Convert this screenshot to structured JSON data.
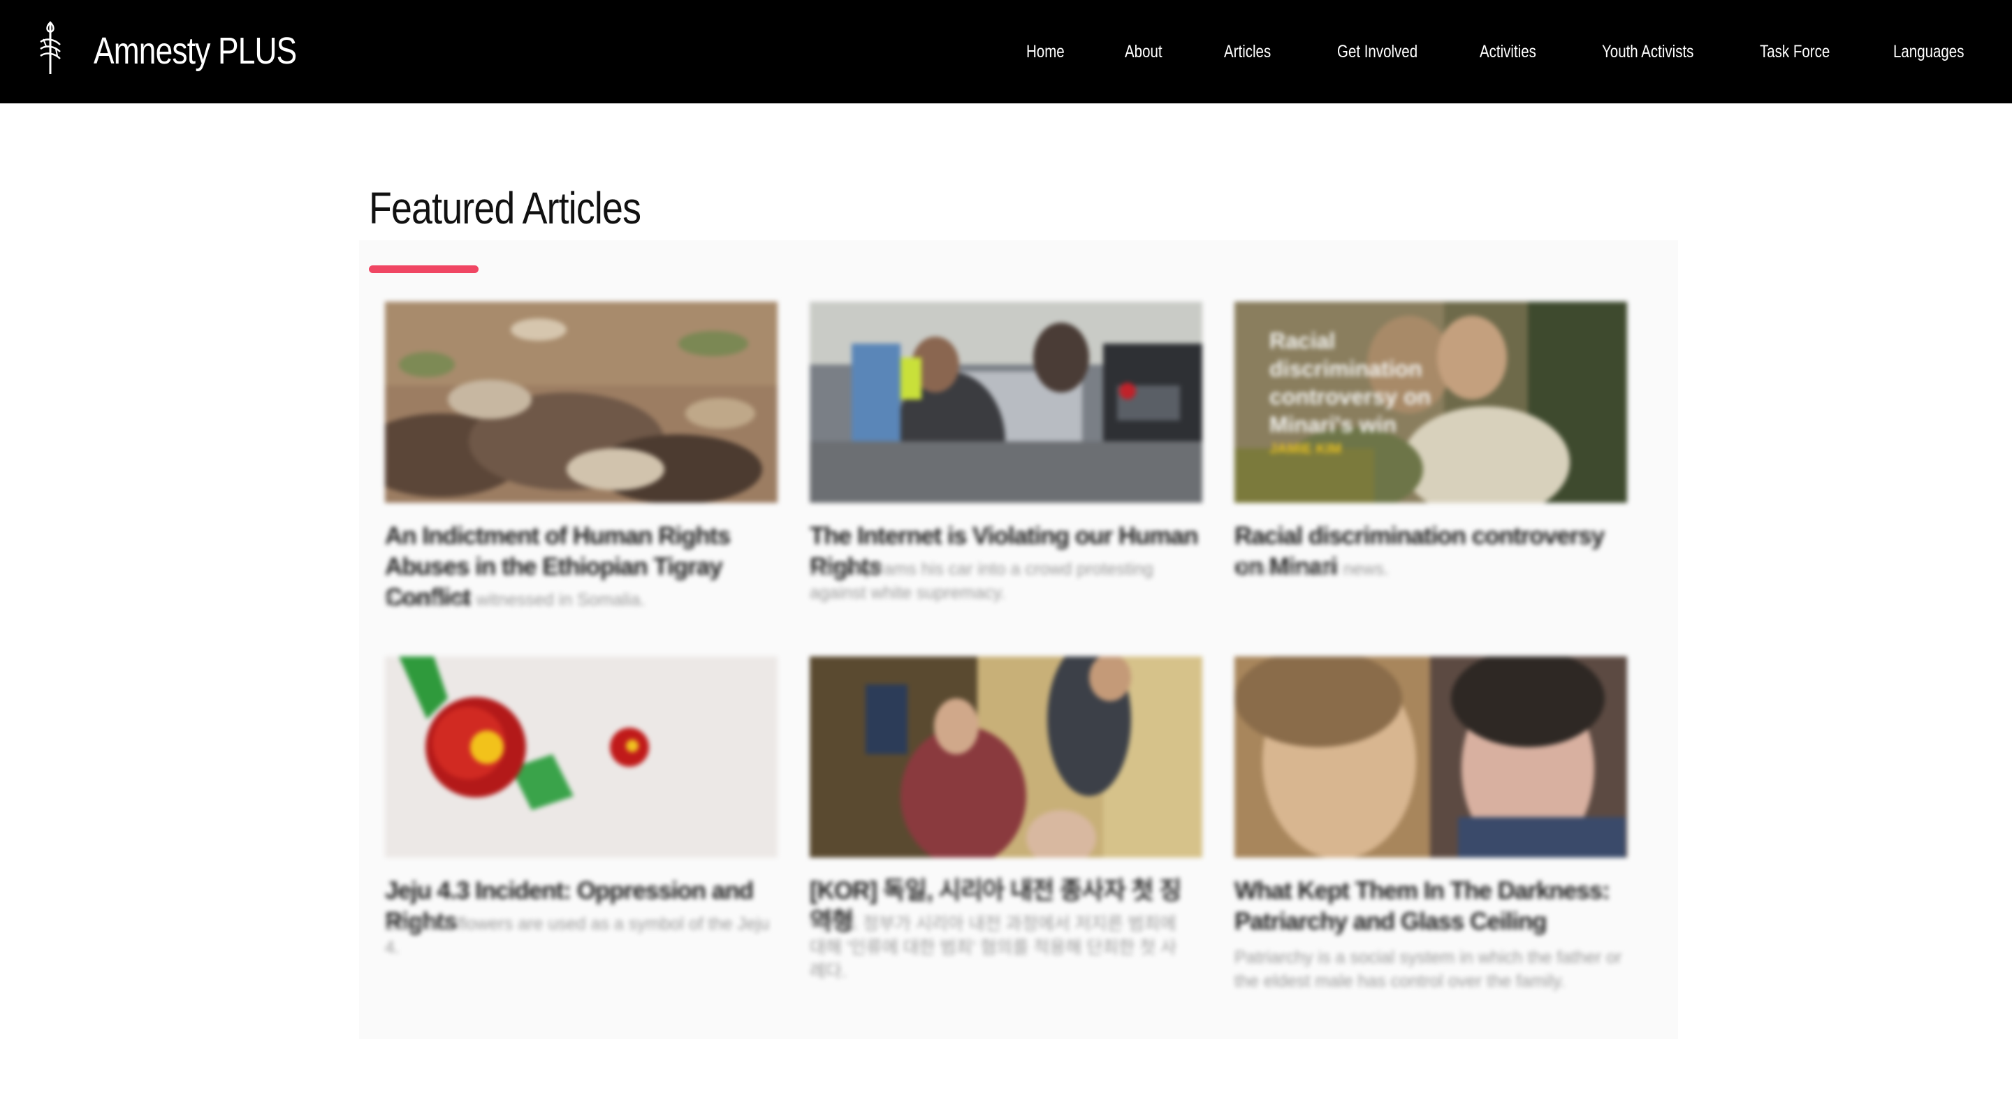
{
  "header": {
    "brand": "Amnesty PLUS",
    "logo_icon": "candle-in-barbed-wire-icon",
    "nav": [
      {
        "label": "Home"
      },
      {
        "label": "About"
      },
      {
        "label": "Articles"
      },
      {
        "label": "Get Involved"
      },
      {
        "label": "Activities"
      },
      {
        "label": "Youth Activists"
      },
      {
        "label": "Task Force"
      },
      {
        "label": "Languages"
      }
    ]
  },
  "section": {
    "title": "Featured Articles",
    "accent_color": "#f04663"
  },
  "articles": [
    {
      "title": "An Indictment of Human Rights Abuses in the Ethiopian Tigray Conflict",
      "desc": "It has been witnessed in Somalia."
    },
    {
      "title": "The Internet is Violating our Human Rights",
      "desc": "violently rams his car into a crowd protesting against white supremacy."
    },
    {
      "title": "Racial discrimination controversy on Minari",
      "desc": "This is a card news.",
      "thumb_text": "Racial discrimination controversy on Minari's win",
      "thumb_cta": "JAMIE KIM"
    },
    {
      "title": "Jeju 4.3 Incident: Oppression and Rights",
      "desc": "Camellia flowers are used as a symbol of the Jeju 4."
    },
    {
      "title": "[KOR] 독일, 시리아 내전 종사자 첫 징역형",
      "desc": "이시드 정부가 시리아 내전 과정에서 저지른 범죄에 대해 '인류에 대한 범죄' 혐의를 적용해 단죄한 첫 사례다."
    },
    {
      "title": "What Kept Them In The Darkness: Patriarchy and Glass Ceiling",
      "desc": "Patriarchy is a social system in which the father or the eldest male has control over the family."
    }
  ]
}
